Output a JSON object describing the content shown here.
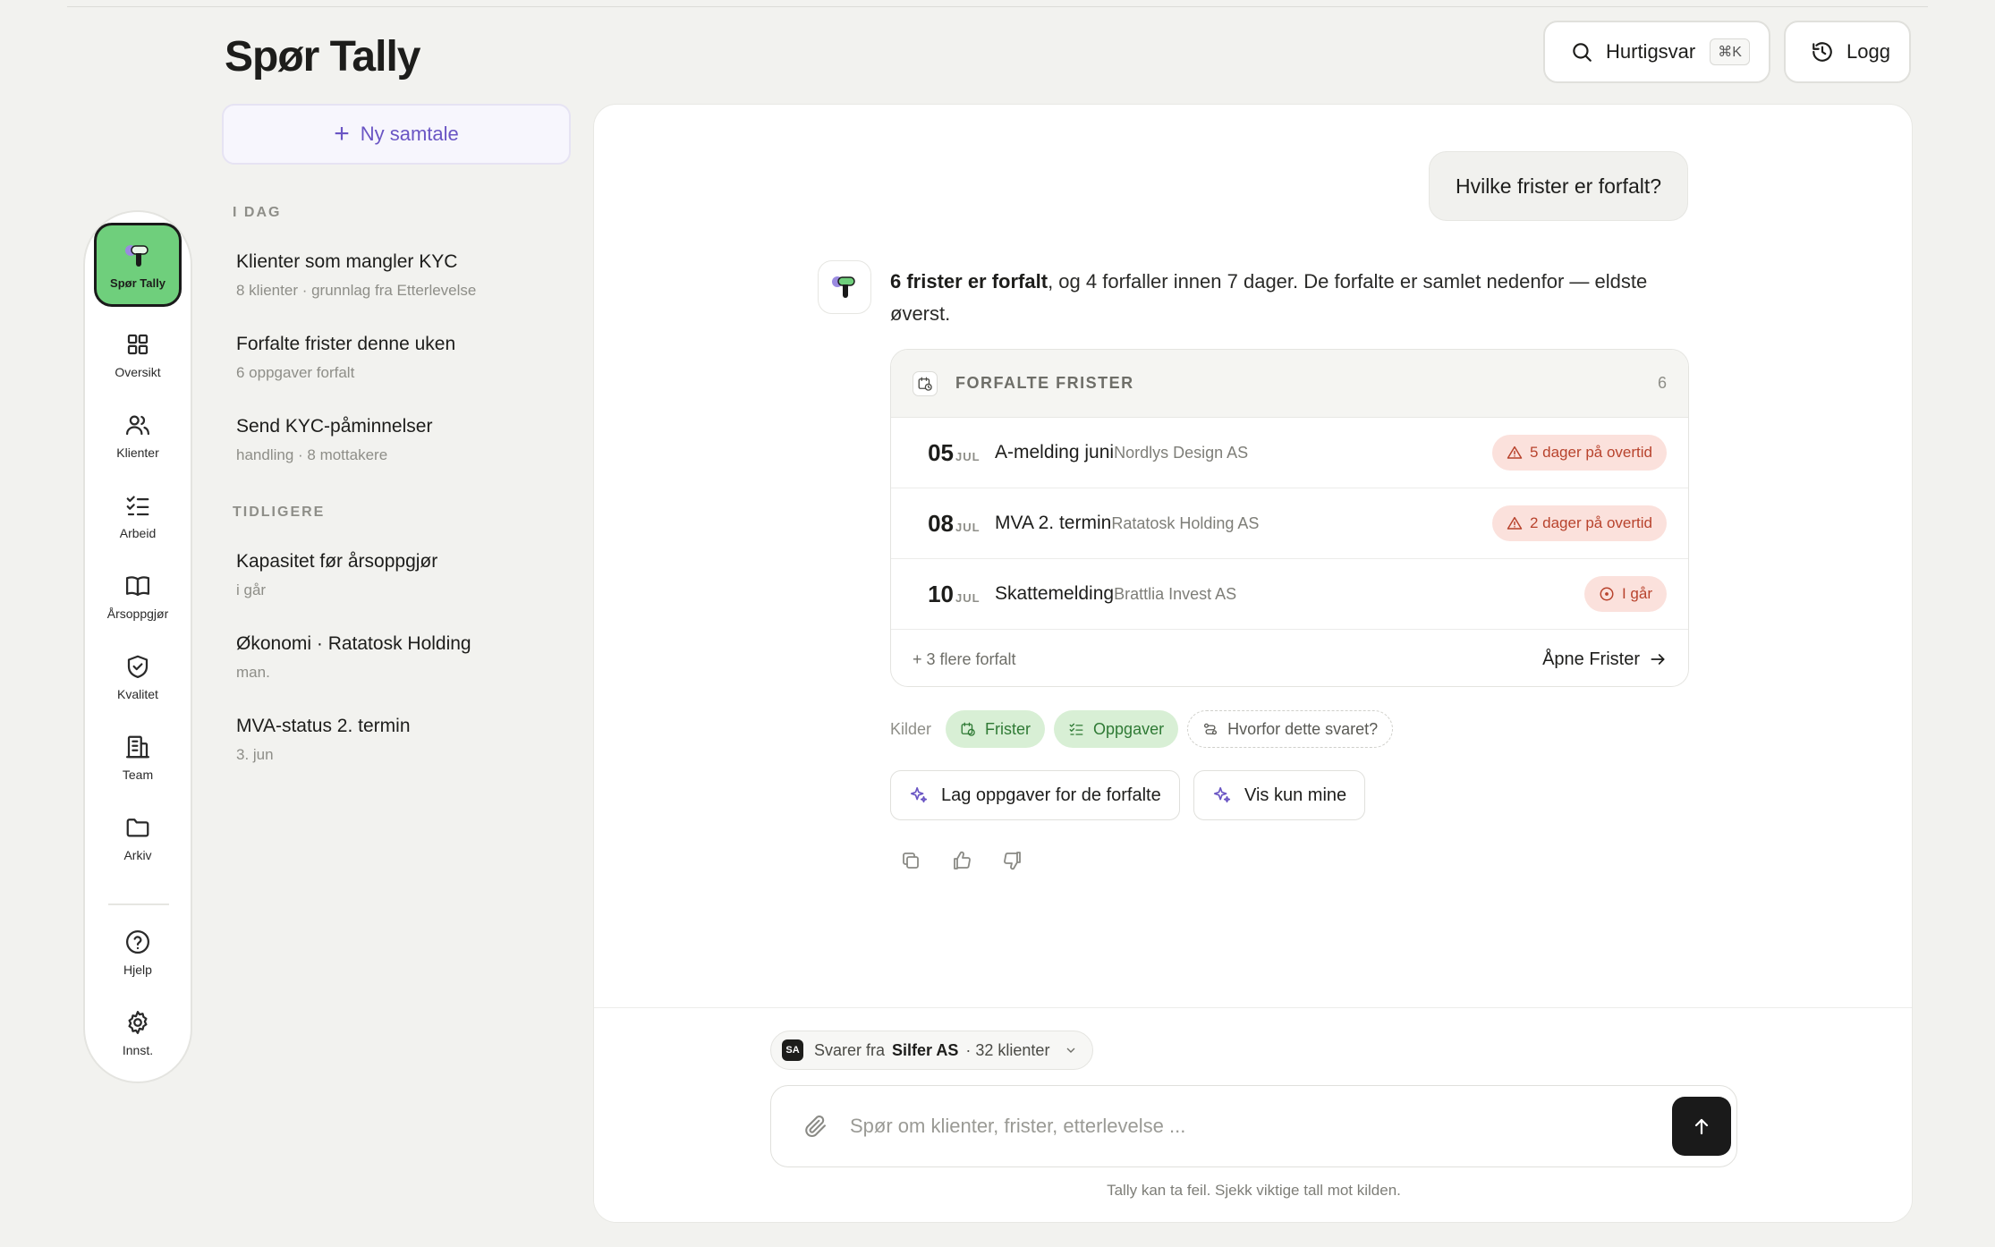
{
  "header": {
    "title": "Spør Tally",
    "quick_label": "Hurtigsvar",
    "quick_shortcut": "⌘K",
    "log_label": "Logg"
  },
  "rail": {
    "brand_label": "Spør Tally",
    "items": [
      {
        "label": "Oversikt",
        "icon": "grid-icon"
      },
      {
        "label": "Klienter",
        "icon": "users-icon"
      },
      {
        "label": "Arbeid",
        "icon": "checklist-icon"
      },
      {
        "label": "Årsoppgjør",
        "icon": "book-icon"
      },
      {
        "label": "Kvalitet",
        "icon": "shield-check-icon"
      },
      {
        "label": "Team",
        "icon": "building-icon"
      },
      {
        "label": "Arkiv",
        "icon": "folder-icon"
      },
      {
        "label": "Hjelp",
        "icon": "help-icon"
      },
      {
        "label": "Innst.",
        "icon": "gear-icon"
      }
    ]
  },
  "history": {
    "new_label": "Ny samtale",
    "today_label": "I DAG",
    "earlier_label": "TIDLIGERE",
    "today": [
      {
        "title": "Klienter som mangler KYC",
        "sub": "8 klienter · grunnlag fra Etterlevelse"
      },
      {
        "title": "Forfalte frister denne uken",
        "sub": "6 oppgaver forfalt"
      },
      {
        "title": "Send KYC-påminnelser",
        "sub": "handling · 8 mottakere"
      }
    ],
    "earlier": [
      {
        "title": "Kapasitet før årsoppgjør",
        "sub": "i går"
      },
      {
        "title": "Økonomi · Ratatosk Holding",
        "sub": "man."
      },
      {
        "title": "MVA-status 2. termin",
        "sub": "3. jun"
      }
    ]
  },
  "chat": {
    "user_message": "Hvilke frister er forfalt?",
    "answer_bold": "6 frister er forfalt",
    "answer_rest": ", og 4 forfaller innen 7 dager. De forfalte er samlet nedenfor — eldste øverst.",
    "card": {
      "title": "FORFALTE FRISTER",
      "count": "6",
      "rows": [
        {
          "day": "05",
          "month": "JUL",
          "name": "A-melding juni",
          "client": "Nordlys Design AS",
          "status": "5 dager på overtid",
          "kind": "warning"
        },
        {
          "day": "08",
          "month": "JUL",
          "name": "MVA 2. termin",
          "client": "Ratatosk Holding AS",
          "status": "2 dager på overtid",
          "kind": "warning"
        },
        {
          "day": "10",
          "month": "JUL",
          "name": "Skattemelding",
          "client": "Brattlia Invest AS",
          "status": "I går",
          "kind": "info"
        }
      ],
      "more": "+ 3 flere forfalt",
      "open_label": "Åpne Frister"
    },
    "sources_label": "Kilder",
    "sources": [
      "Frister",
      "Oppgaver"
    ],
    "why_label": "Hvorfor dette svaret?",
    "actions": [
      "Lag oppgaver for de forfalte",
      "Vis kun mine"
    ]
  },
  "composer": {
    "org_initials": "SA",
    "org_prefix": "Svarer fra",
    "org_name": "Silfer AS",
    "org_clients": "· 32 klienter",
    "placeholder": "Spør om klienter, frister, etterlevelse ...",
    "disclaimer": "Tally kan ta feil. Sjekk viktige tall mot kilden."
  },
  "colors": {
    "accent": "#6a55c4",
    "brand_green": "#6fcf7c",
    "overdue_bg": "#fbe1dc",
    "overdue_text": "#b8432d",
    "source_green_bg": "#d8efd5"
  }
}
